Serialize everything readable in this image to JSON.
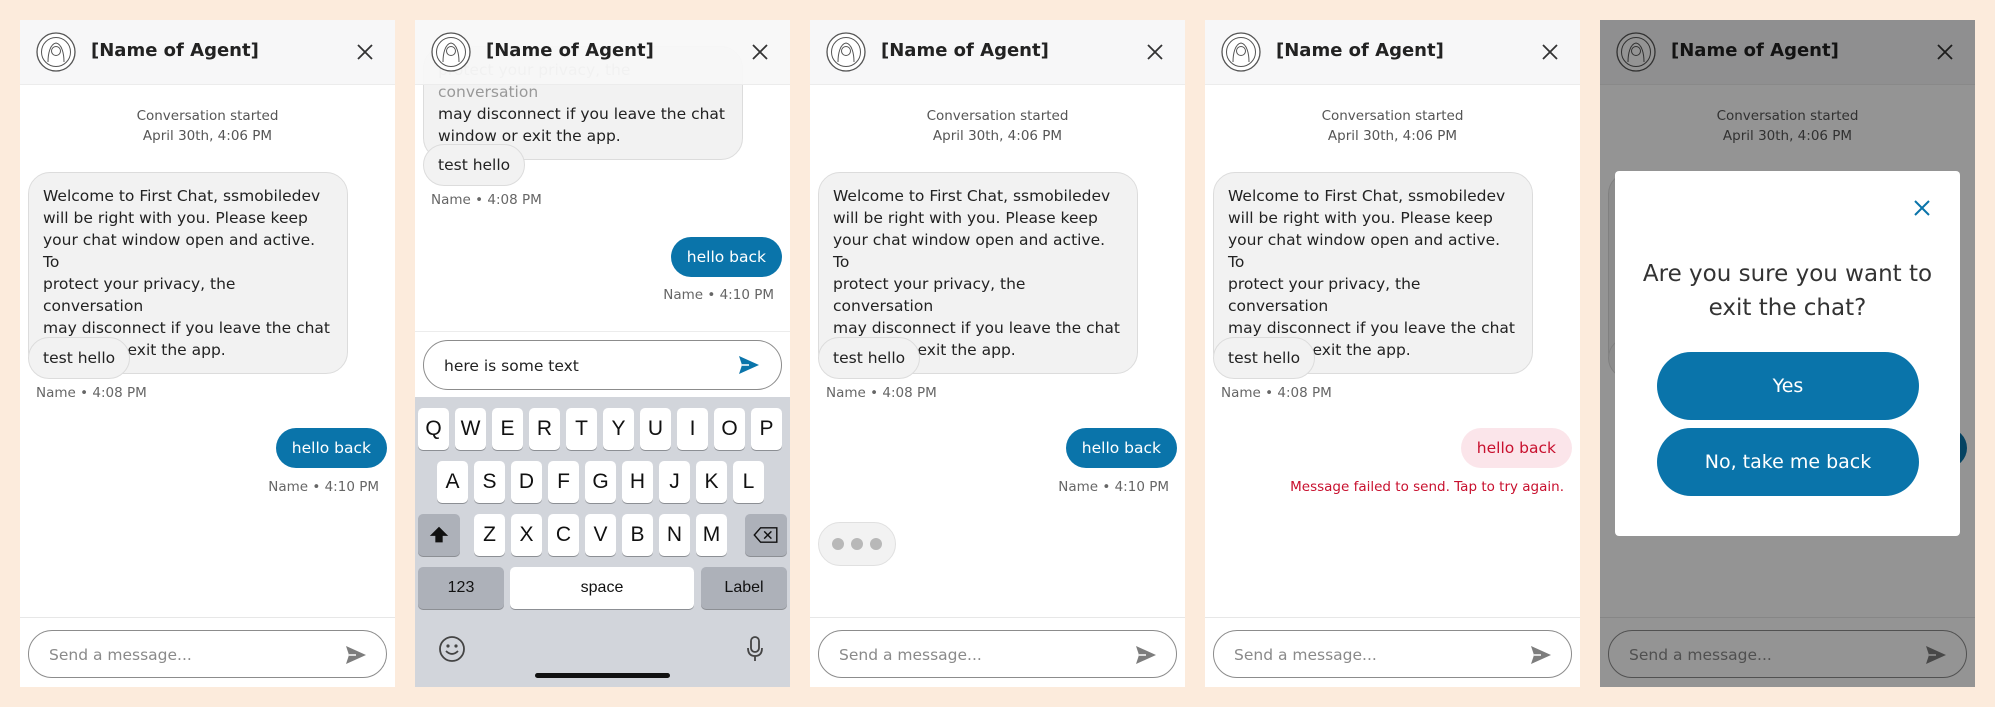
{
  "agent_name": "[Name of Agent]",
  "conversation_started_label": "Conversation started",
  "conversation_started_time": "April 30th, 4:06 PM",
  "welcome_message_lines": [
    "Welcome to First Chat, ssmobiledev",
    "will be right with you. Please keep",
    "your chat window open and active. To",
    "protect your privacy, the conversation",
    "may disconnect if you leave the chat",
    "window or exit the app."
  ],
  "partial_message_lines": [
    "may disconnect if you leave the chat",
    "window or exit the app."
  ],
  "user_message": "test hello",
  "user_meta": "Name • 4:08 PM",
  "agent_reply": "hello back",
  "agent_meta": "Name • 4:10 PM",
  "failed_text": "Message failed to send. Tap to try again.",
  "composer_placeholder": "Send a message...",
  "typed_text": "here is some text",
  "modal": {
    "question_line1": "Are you sure you want to",
    "question_line2": "exit the chat?",
    "yes_label": "Yes",
    "no_label": "No, take me back"
  },
  "keyboard": {
    "row1": [
      "Q",
      "W",
      "E",
      "R",
      "T",
      "Y",
      "U",
      "I",
      "O",
      "P"
    ],
    "row2": [
      "A",
      "S",
      "D",
      "F",
      "G",
      "H",
      "J",
      "K",
      "L"
    ],
    "row3": [
      "Z",
      "X",
      "C",
      "V",
      "B",
      "N",
      "M"
    ],
    "numbers_label": "123",
    "space_label": "space",
    "return_label": "Label"
  },
  "colors": {
    "brand_blue": "#0a74aa",
    "error_red": "#c8102e",
    "page_background": "#fcebdc"
  },
  "icons": [
    "avatar-icon",
    "close-icon",
    "send-icon",
    "shift-icon",
    "backspace-icon",
    "emoji-icon",
    "microphone-icon"
  ]
}
